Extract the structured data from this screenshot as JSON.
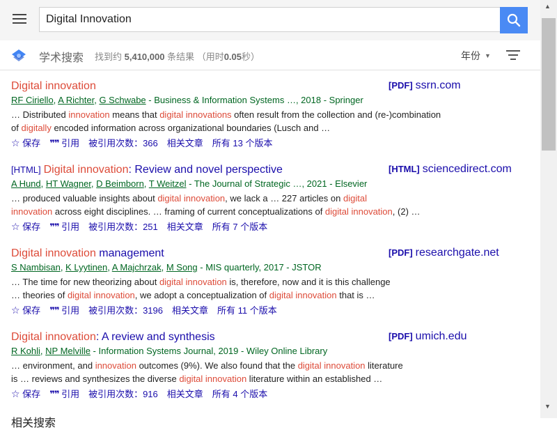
{
  "search": {
    "query": "Digital Innovation"
  },
  "header": {
    "brand": "学术搜索",
    "stats_prefix": "找到约 ",
    "stats_count": "5,410,000",
    "stats_mid": " 条结果  （用时",
    "stats_time": "0.05",
    "stats_suffix": "秒）",
    "year_filter": "年份"
  },
  "results": [
    {
      "tag": "",
      "title_hl": "Digital innovation",
      "title_rest": "",
      "side_type": "[PDF]",
      "side_domain": "ssrn.com",
      "authors": [
        "RF Ciriello",
        "A Richter",
        "G Schwabe"
      ],
      "venue": " - Business & Information Systems …, 2018 - Springer",
      "snippet": [
        [
          [
            "… Distributed ",
            false
          ],
          [
            "innovation",
            true
          ],
          [
            " means that ",
            false
          ],
          [
            "digital innovations",
            true
          ],
          [
            " often result from the collection and (re-)combination",
            false
          ]
        ],
        [
          [
            "of ",
            false
          ],
          [
            "digitally",
            true
          ],
          [
            " encoded information across organizational boundaries (Lusch and …",
            false
          ]
        ]
      ],
      "save": "保存",
      "cite": "引用",
      "cited_by": "被引用次数：366",
      "related": "相关文章",
      "versions": "所有 13 个版本"
    },
    {
      "tag": "[HTML]",
      "title_hl": "Digital innovation",
      "title_rest": ": Review and novel perspective",
      "side_type": "[HTML]",
      "side_domain": "sciencedirect.com",
      "authors": [
        "A Hund",
        "HT Wagner",
        "D Beimborn",
        "T Weitzel"
      ],
      "venue": " - The Journal of Strategic …, 2021 - Elsevier",
      "snippet": [
        [
          [
            "… produced valuable insights about ",
            false
          ],
          [
            "digital innovation",
            true
          ],
          [
            ", we lack a … 227 articles on ",
            false
          ],
          [
            "digital",
            true
          ]
        ],
        [
          [
            "innovation",
            true
          ],
          [
            " across eight disciplines. … framing of current conceptualizations of ",
            false
          ],
          [
            "digital innovation",
            true
          ],
          [
            ", (2) …",
            false
          ]
        ]
      ],
      "save": "保存",
      "cite": "引用",
      "cited_by": "被引用次数：251",
      "related": "相关文章",
      "versions": "所有 7 个版本"
    },
    {
      "tag": "",
      "title_hl": "Digital innovation",
      "title_rest": " management",
      "side_type": "[PDF]",
      "side_domain": "researchgate.net",
      "authors": [
        "S Nambisan",
        "K Lyytinen",
        "A Majchrzak",
        "M Song"
      ],
      "venue": " - MIS quarterly, 2017 - JSTOR",
      "snippet": [
        [
          [
            "… The time for new theorizing about ",
            false
          ],
          [
            "digital innovation",
            true
          ],
          [
            " is, therefore, now and it is this challenge",
            false
          ]
        ],
        [
          [
            "… theories of ",
            false
          ],
          [
            "digital innovation",
            true
          ],
          [
            ", we adopt a conceptualization of ",
            false
          ],
          [
            "digital innovation",
            true
          ],
          [
            " that is …",
            false
          ]
        ]
      ],
      "save": "保存",
      "cite": "引用",
      "cited_by": "被引用次数：3196",
      "related": "相关文章",
      "versions": "所有 11 个版本"
    },
    {
      "tag": "",
      "title_hl": "Digital innovation",
      "title_rest": ": A review and synthesis",
      "side_type": "[PDF]",
      "side_domain": "umich.edu",
      "authors": [
        "R Kohli",
        "NP Melville"
      ],
      "venue": " - Information Systems Journal, 2019 - Wiley Online Library",
      "snippet": [
        [
          [
            "… environment, and ",
            false
          ],
          [
            "innovation",
            true
          ],
          [
            " outcomes (9%). We also found that the ",
            false
          ],
          [
            "digital innovation",
            true
          ],
          [
            " literature",
            false
          ]
        ],
        [
          [
            "is … reviews and synthesizes the diverse ",
            false
          ],
          [
            "digital innovation",
            true
          ],
          [
            " literature within an established …",
            false
          ]
        ]
      ],
      "save": "保存",
      "cite": "引用",
      "cited_by": "被引用次数：916",
      "related": "相关文章",
      "versions": "所有 4 个版本"
    }
  ],
  "footer": {
    "related_searches": "相关搜索"
  },
  "colors": {
    "link": "#1a0dab",
    "highlight": "#dd4b39",
    "author": "#006621",
    "search_button": "#4a8af4"
  },
  "icons": [
    "menu-icon",
    "search-icon",
    "scholar-logo-icon",
    "caret-down-icon",
    "filter-icon",
    "star-icon",
    "quote-icon"
  ]
}
